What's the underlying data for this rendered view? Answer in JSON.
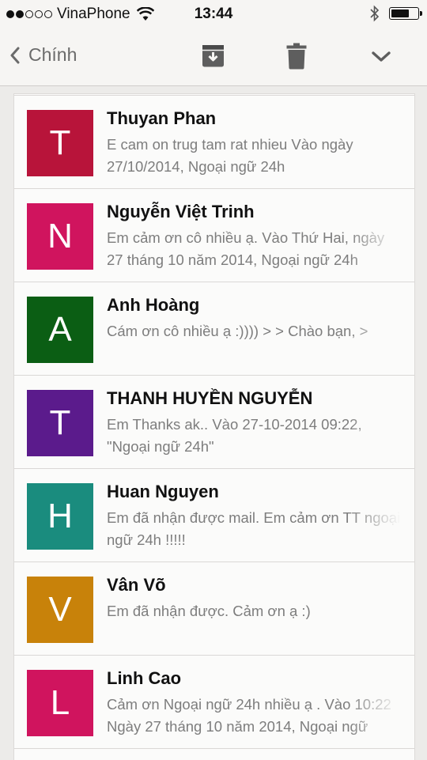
{
  "status": {
    "carrier": "VinaPhone",
    "time": "13:44",
    "signal_bars_filled": 2,
    "signal_bars_total": 5,
    "battery_level": 0.6
  },
  "nav": {
    "back_label": "Chính",
    "icons": [
      "archive-icon",
      "trash-icon",
      "chevron-down-icon"
    ]
  },
  "messages": [
    {
      "initial": "T",
      "color": "#b8143a",
      "sender": "Thuyan Phan",
      "preview": "E cam on trug tam rat nhieu Vào ngày 27/10/2014, Ngoại ngữ 24h"
    },
    {
      "initial": "N",
      "color": "#d0145e",
      "sender": "Nguyễn Việt Trinh",
      "preview": "Em cảm ơn cô nhiều ạ. Vào Thứ Hai, ngày 27 tháng 10 năm 2014, Ngoại ngữ 24h"
    },
    {
      "initial": "A",
      "color": "#0b5e14",
      "sender": "Anh Hoàng",
      "preview": "Cám ơn cô nhiều ạ :)))) > > Chào bạn, >"
    },
    {
      "initial": "T",
      "color": "#5b1b8c",
      "sender": "THANH HUYỀN NGUYỄN",
      "preview": "Em Thanks ak.. Vào 27-10-2014 09:22, \"Ngoại ngữ 24h\""
    },
    {
      "initial": "H",
      "color": "#1a8c7e",
      "sender": "Huan Nguyen",
      "preview": "Em đã nhận được mail. Em cảm ơn TT ngoại ngữ 24h !!!!!"
    },
    {
      "initial": "V",
      "color": "#c8820a",
      "sender": "Vân Võ",
      "preview": "Em đã nhận được. Cảm ơn ạ :)"
    },
    {
      "initial": "L",
      "color": "#d0145e",
      "sender": "Linh Cao",
      "preview": "Cảm ơn Ngoại ngữ 24h nhiều ạ . Vào 10:22 Ngày 27 tháng 10 năm 2014, Ngoại ngữ"
    }
  ]
}
